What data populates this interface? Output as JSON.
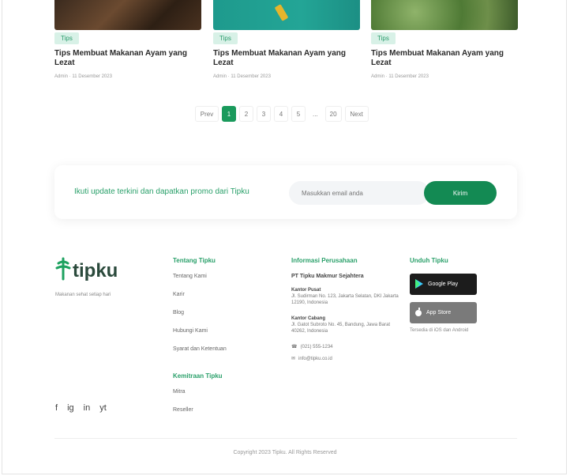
{
  "articles": [
    {
      "tag": "Tips",
      "title": "Tips Membuat Makanan Ayam yang Lezat",
      "meta": "Admin · 11 Desember 2023"
    },
    {
      "tag": "Tips",
      "title": "Tips Membuat Makanan Ayam yang Lezat",
      "meta": "Admin · 11 Desember 2023"
    },
    {
      "tag": "Tips",
      "title": "Tips Membuat Makanan Ayam yang Lezat",
      "meta": "Admin · 11 Desember 2023"
    }
  ],
  "pagination": {
    "prev": "Prev",
    "pages": [
      "1",
      "2",
      "3",
      "4",
      "5"
    ],
    "ellipsis": "...",
    "last": "20",
    "next": "Next",
    "active": "1"
  },
  "newsletter": {
    "text": "Ikuti update terkini dan dapatkan promo dari Tipku",
    "placeholder": "Masukkan email anda",
    "button": "Kirim"
  },
  "footer": {
    "logo_word": "tipku",
    "tagline": "Makanan sehat setiap hari",
    "col1": {
      "heading": "Tentang Tipku",
      "links": [
        "Tentang Kami",
        "Karir",
        "Blog",
        "Hubungi Kami",
        "Syarat dan Ketentuan"
      ]
    },
    "col1b": {
      "heading": "Kemitraan Tipku",
      "links": [
        "Mitra",
        "Reseller"
      ]
    },
    "col2": {
      "heading": "Informasi Perusahaan",
      "company": "PT Tipku Makmur Sejahtera",
      "addr1_label": "Kantor Pusat",
      "addr1": "Jl. Sudirman No. 123, Jakarta Selatan, DKI Jakarta 12190, Indonesia",
      "addr2_label": "Kantor Cabang",
      "addr2": "Jl. Gatot Subroto No. 45, Bandung, Jawa Barat 40262, Indonesia",
      "phone": "(021) 555-1234",
      "email": "info@tipku.co.id"
    },
    "col3": {
      "heading": "Unduh Tipku",
      "google_play": "Google Play",
      "app_store": "App Store",
      "note": "Tersedia di iOS dan Android"
    },
    "social": [
      "f",
      "ig",
      "in",
      "yt"
    ],
    "copyright": "Copyright 2023 Tipku. All Rights Reserved"
  },
  "colors": {
    "brand": "#1a9a5c",
    "accent_text": "#2aa06a"
  }
}
